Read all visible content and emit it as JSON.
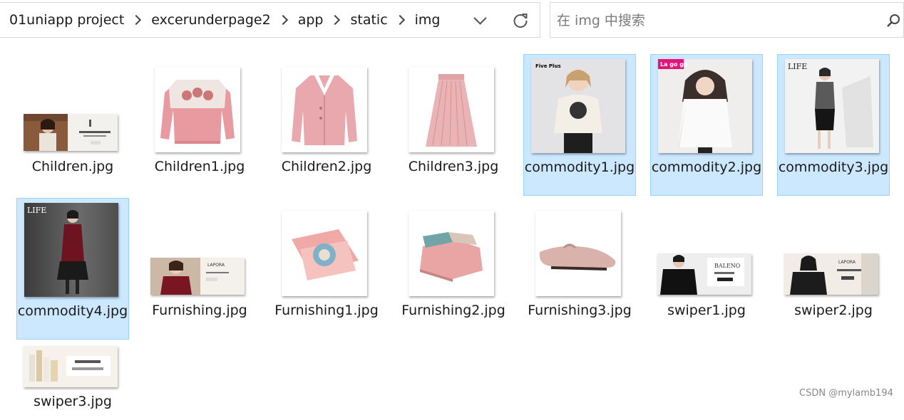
{
  "address_bar": {
    "breadcrumbs": [
      "01uniapp project",
      "excerunderpage2",
      "app",
      "static",
      "img"
    ]
  },
  "search": {
    "placeholder": "在 img 中搜索",
    "value": ""
  },
  "files": [
    {
      "name": "Children.jpg"
    },
    {
      "name": "Children1.jpg"
    },
    {
      "name": "Children2.jpg"
    },
    {
      "name": "Children3.jpg"
    },
    {
      "name": "commodity1.jpg",
      "selected": true
    },
    {
      "name": "commodity2.jpg",
      "selected": true
    },
    {
      "name": "commodity3.jpg",
      "selected": true
    },
    {
      "name": "commodity4.jpg",
      "selected": true
    },
    {
      "name": "Furnishing.jpg"
    },
    {
      "name": "Furnishing1.jpg"
    },
    {
      "name": "Furnishing2.jpg"
    },
    {
      "name": "Furnishing3.jpg"
    },
    {
      "name": "swiper1.jpg"
    },
    {
      "name": "swiper2.jpg"
    },
    {
      "name": "swiper3.jpg"
    }
  ],
  "thumb_text": {
    "commodity1": "Five Plus",
    "commodity2": "La go go",
    "commodity3": "LIFE",
    "commodity4": "LIFE",
    "furnishing": "LAPORA",
    "swiper1": "BALENO",
    "swiper2": "LAPORA"
  },
  "watermark": "CSDN @mylamb194",
  "colors": {
    "selection_bg": "#cce8ff",
    "selection_border": "#99d1ff"
  }
}
